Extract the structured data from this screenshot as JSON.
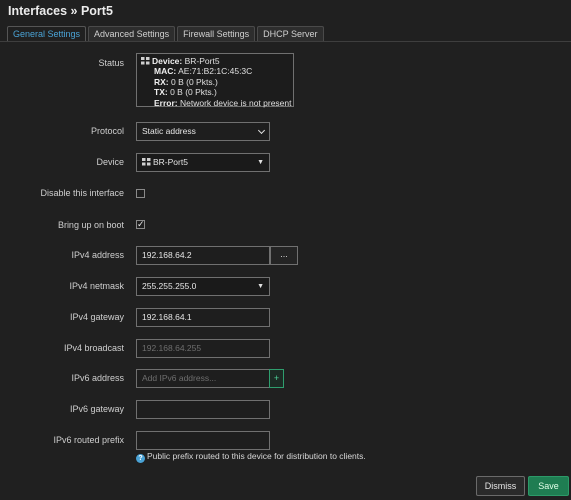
{
  "page": {
    "title": "Interfaces » Port5"
  },
  "tabs": [
    {
      "label": "General Settings",
      "active": true
    },
    {
      "label": "Advanced Settings",
      "active": false
    },
    {
      "label": "Firewall Settings",
      "active": false
    },
    {
      "label": "DHCP Server",
      "active": false
    }
  ],
  "status": {
    "label": "Status",
    "device_key": "Device:",
    "device_val": "BR-Port5",
    "mac_key": "MAC:",
    "mac_val": "AE:71:B2:1C:45:3C",
    "rx_key": "RX:",
    "rx_val": "0 B (0 Pkts.)",
    "tx_key": "TX:",
    "tx_val": "0 B (0 Pkts.)",
    "error_key": "Error:",
    "error_val": "Network device is not present"
  },
  "protocol": {
    "label": "Protocol",
    "value": "Static address"
  },
  "device": {
    "label": "Device",
    "value": "BR-Port5"
  },
  "disable_iface": {
    "label": "Disable this interface",
    "checked": false
  },
  "bring_up": {
    "label": "Bring up on boot",
    "checked": true,
    "mark": "✓"
  },
  "ipv4_address": {
    "label": "IPv4 address",
    "value": "192.168.64.2",
    "more_label": "..."
  },
  "ipv4_netmask": {
    "label": "IPv4 netmask",
    "value": "255.255.255.0"
  },
  "ipv4_gateway": {
    "label": "IPv4 gateway",
    "value": "192.168.64.1"
  },
  "ipv4_broadcast": {
    "label": "IPv4 broadcast",
    "placeholder": "192.168.64.255"
  },
  "ipv6_address": {
    "label": "IPv6 address",
    "placeholder": "Add IPv6 address...",
    "add_label": "+"
  },
  "ipv6_gateway": {
    "label": "IPv6 gateway",
    "value": ""
  },
  "ipv6_prefix": {
    "label": "IPv6 routed prefix",
    "value": "",
    "hint": "Public prefix routed to this device for distribution to clients.",
    "hint_icon": "?"
  },
  "footer": {
    "dismiss_label": "Dismiss",
    "save_label": "Save"
  },
  "colors": {
    "accent": "#4aa3d6",
    "save": "#1f7d52",
    "background": "#202020"
  }
}
